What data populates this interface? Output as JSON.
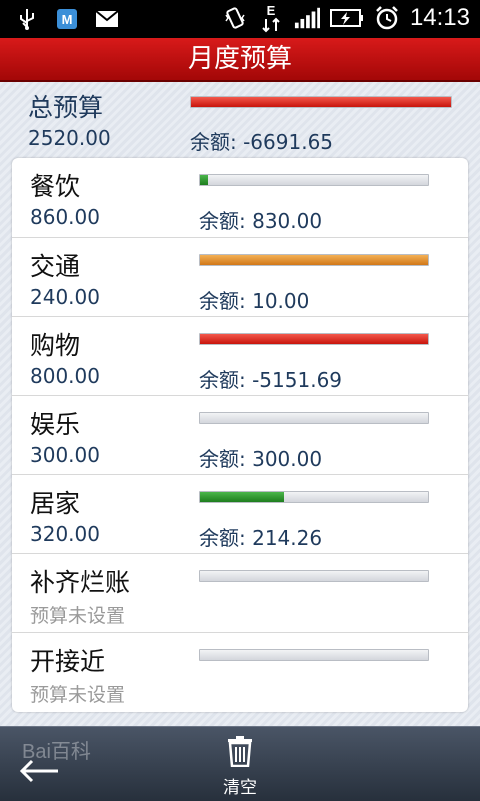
{
  "status_bar": {
    "time": "14:13",
    "network_label": "E",
    "icons": [
      "usb-icon",
      "maps-icon",
      "mail-icon",
      "vibrate-icon",
      "data-icon",
      "signal-icon",
      "battery-charging-icon",
      "alarm-icon"
    ]
  },
  "title": "月度预算",
  "total": {
    "name": "总预算",
    "amount": "2520.00",
    "remaining": "余额: -6691.65",
    "progress": 1.0,
    "color": "#d9251c"
  },
  "categories": [
    {
      "name": "餐饮",
      "amount": "860.00",
      "remaining": "余额: 830.00",
      "progress": 0.035,
      "status": "green"
    },
    {
      "name": "交通",
      "amount": "240.00",
      "remaining": "余额: 10.00",
      "progress": 1.0,
      "status": "orange"
    },
    {
      "name": "购物",
      "amount": "800.00",
      "remaining": "余额: -5151.69",
      "progress": 1.0,
      "status": "red"
    },
    {
      "name": "娱乐",
      "amount": "300.00",
      "remaining": "余额: 300.00",
      "progress": 0.0,
      "status": "green"
    },
    {
      "name": "居家",
      "amount": "320.00",
      "remaining": "余额: 214.26",
      "progress": 0.37,
      "status": "green"
    },
    {
      "name": "补齐烂账",
      "amount": "预算未设置",
      "remaining": "",
      "progress": 0.0,
      "status": "unset"
    },
    {
      "name": "开接近",
      "amount": "预算未设置",
      "remaining": "",
      "progress": 0.0,
      "status": "unset"
    }
  ],
  "toolbar": {
    "clear_label": "清空",
    "watermark": "Bai百科"
  },
  "colors": {
    "title_bar": "#c20f0f",
    "red": "#d9251c",
    "orange": "#e08a28",
    "green": "#2e9a2e"
  }
}
